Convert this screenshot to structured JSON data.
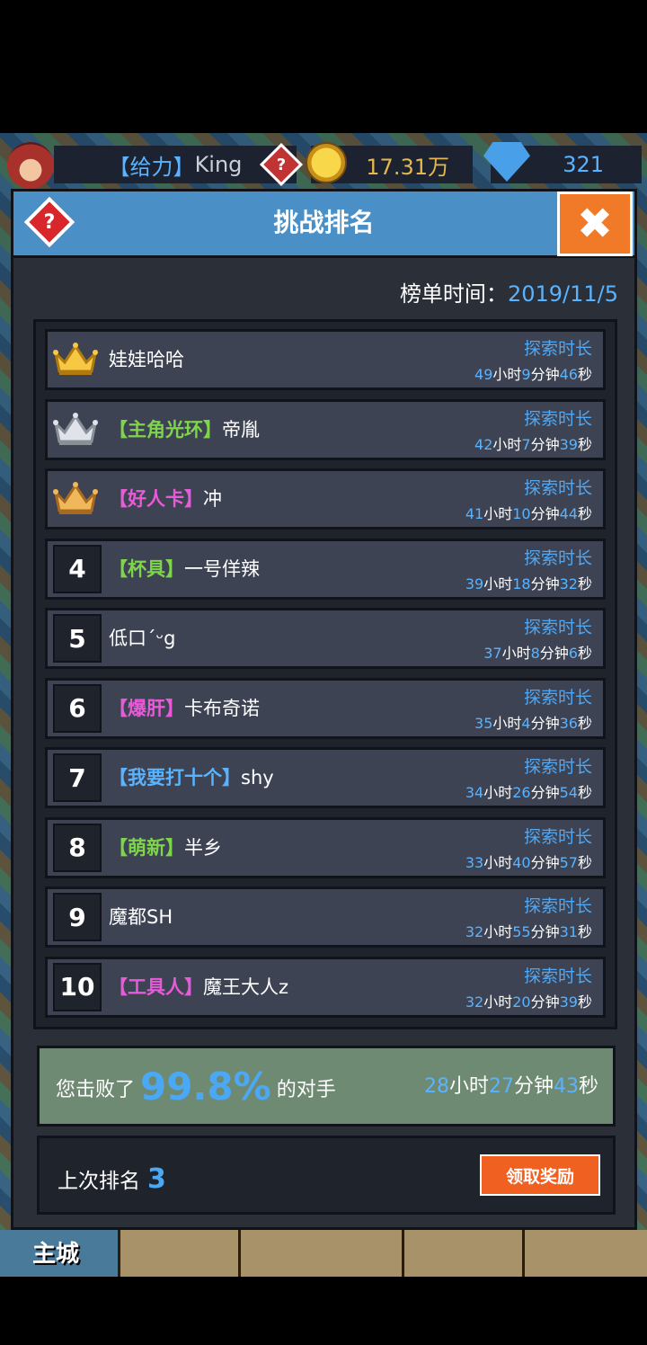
{
  "topbar": {
    "player_tag": "【给力】",
    "player_name": "King",
    "gold": "17.31万",
    "gems": "321"
  },
  "panel": {
    "title": "挑战排名",
    "close_symbol": "✖",
    "help_symbol": "?",
    "rank_date_label": "榜单时间：",
    "rank_date": "2019/11/5"
  },
  "rows": [
    {
      "rank": "",
      "crown": "gold",
      "tag": "",
      "tag_color": "#fff",
      "name": "娃娃哈哈",
      "label": "探索时长",
      "h": "49",
      "m": "9",
      "s": "46"
    },
    {
      "rank": "",
      "crown": "silver",
      "tag": "【主角光环】",
      "tag_color": "#7ed44a",
      "name": "帝胤",
      "label": "探索时长",
      "h": "42",
      "m": "7",
      "s": "39"
    },
    {
      "rank": "",
      "crown": "bronze",
      "tag": "【好人卡】",
      "tag_color": "#e85bd8",
      "name": "冲",
      "label": "探索时长",
      "h": "41",
      "m": "10",
      "s": "44"
    },
    {
      "rank": "4",
      "crown": "",
      "tag": "【杯具】",
      "tag_color": "#7ed44a",
      "name": "一号佯辣",
      "label": "探索时长",
      "h": "39",
      "m": "18",
      "s": "32"
    },
    {
      "rank": "5",
      "crown": "",
      "tag": "",
      "tag_color": "#fff",
      "name": "低口´ᵕg",
      "label": "探索时长",
      "h": "37",
      "m": "8",
      "s": "6"
    },
    {
      "rank": "6",
      "crown": "",
      "tag": "【爆肝】",
      "tag_color": "#e85bd8",
      "name": "卡布奇诺",
      "label": "探索时长",
      "h": "35",
      "m": "4",
      "s": "36"
    },
    {
      "rank": "7",
      "crown": "",
      "tag": "【我要打十个】",
      "tag_color": "#5ab3ff",
      "name": "shy",
      "label": "探索时长",
      "h": "34",
      "m": "26",
      "s": "54"
    },
    {
      "rank": "8",
      "crown": "",
      "tag": "【萌新】",
      "tag_color": "#7ed44a",
      "name": "半乡",
      "label": "探索时长",
      "h": "33",
      "m": "40",
      "s": "57"
    },
    {
      "rank": "9",
      "crown": "",
      "tag": "",
      "tag_color": "#fff",
      "name": "魔都SH",
      "label": "探索时长",
      "h": "32",
      "m": "55",
      "s": "31"
    },
    {
      "rank": "10",
      "crown": "",
      "tag": "【工具人】",
      "tag_color": "#e85bd8",
      "name": "魔王大人z",
      "label": "探索时长",
      "h": "32",
      "m": "20",
      "s": "39"
    }
  ],
  "units": {
    "h": "小时",
    "m": "分钟",
    "s": "秒"
  },
  "beat": {
    "prefix": "您击败了",
    "percent": "99.8%",
    "suffix": "的对手",
    "h": "28",
    "m": "27",
    "s": "43"
  },
  "last_rank": {
    "label": "上次排名",
    "value": "3",
    "button": "领取奖励"
  },
  "bottom_nav": {
    "city_label": "主城"
  },
  "colors": {
    "accent_blue": "#5ab3ff",
    "header_blue": "#4a90c6",
    "close_orange": "#f07a28",
    "claim_orange": "#f06020"
  }
}
